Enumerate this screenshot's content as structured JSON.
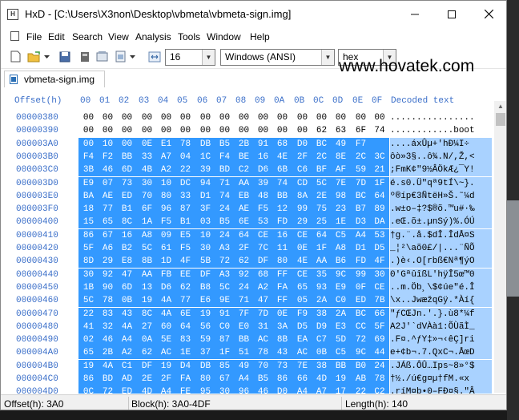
{
  "window": {
    "title": "HxD - [C:\\Users\\X3non\\Desktop\\vbmeta\\vbmeta-sign.img]"
  },
  "menu": [
    "File",
    "Edit",
    "Search",
    "View",
    "Analysis",
    "Tools",
    "Window",
    "Help"
  ],
  "toolbar": {
    "bytes_per_row": "16",
    "charset": "Windows (ANSI)",
    "display_mode": "hex"
  },
  "watermark": "www.hovatek.com",
  "tab": {
    "label": "vbmeta-sign.img"
  },
  "header": {
    "offset_label": "Offset(h)",
    "columns": [
      "00",
      "01",
      "02",
      "03",
      "04",
      "05",
      "06",
      "07",
      "08",
      "09",
      "0A",
      "0B",
      "0C",
      "0D",
      "0E",
      "0F"
    ],
    "decoded_label": "Decoded text"
  },
  "rows": [
    {
      "offset": "00000380",
      "bytes": [
        "00",
        "00",
        "00",
        "00",
        "00",
        "00",
        "00",
        "00",
        "00",
        "00",
        "00",
        "00",
        "00",
        "00",
        "00",
        "00"
      ],
      "decoded": "................"
    },
    {
      "offset": "00000390",
      "bytes": [
        "00",
        "00",
        "00",
        "00",
        "00",
        "00",
        "00",
        "00",
        "00",
        "00",
        "00",
        "00",
        "62",
        "63",
        "6F",
        "74"
      ],
      "decoded": "............boot"
    },
    {
      "offset": "000003A0",
      "bytes": [
        "00",
        "10",
        "00",
        "0E",
        "E1",
        "78",
        "DB",
        "B5",
        "2B",
        "91",
        "68",
        "D0",
        "BC",
        "49",
        "F7",
        ""
      ],
      "decoded": "....áxÛµ+'hÐ¼I÷"
    },
    {
      "offset": "000003B0",
      "bytes": [
        "F4",
        "F2",
        "BB",
        "33",
        "A7",
        "04",
        "1C",
        "F4",
        "BE",
        "16",
        "4E",
        "2F",
        "2C",
        "8E",
        "2C",
        "3C"
      ],
      "decoded": "ôò»3§..ô¾.N/,Ž,<"
    },
    {
      "offset": "000003C0",
      "bytes": [
        "3B",
        "46",
        "6D",
        "4B",
        "A2",
        "22",
        "39",
        "BD",
        "C2",
        "D6",
        "6B",
        "C6",
        "BF",
        "AF",
        "59",
        "21"
      ],
      "decoded": ";FmK¢\"9½ÂÖkÆ¿¯Y!"
    },
    {
      "offset": "000003D0",
      "bytes": [
        "E9",
        "07",
        "73",
        "30",
        "10",
        "DC",
        "94",
        "71",
        "AA",
        "39",
        "74",
        "CD",
        "5C",
        "7E",
        "7D",
        "1F"
      ],
      "decoded": "é.s0.Ü\"qª9tÍ\\~}."
    },
    {
      "offset": "000003E0",
      "bytes": [
        "BA",
        "AE",
        "ED",
        "70",
        "80",
        "33",
        "D1",
        "74",
        "EB",
        "48",
        "BB",
        "8A",
        "2E",
        "98",
        "BC",
        "64"
      ],
      "decoded": "º®íp€3ÑtëH»Š.˜¼d"
    },
    {
      "offset": "000003F0",
      "bytes": [
        "18",
        "77",
        "B1",
        "6F",
        "96",
        "87",
        "3F",
        "24",
        "AE",
        "F5",
        "12",
        "99",
        "75",
        "23",
        "B7",
        "89"
      ],
      "decoded": ".w±o–‡?$®õ.™u#·‰"
    },
    {
      "offset": "00000400",
      "bytes": [
        "15",
        "65",
        "8C",
        "1A",
        "F5",
        "B1",
        "03",
        "B5",
        "6E",
        "53",
        "FD",
        "29",
        "25",
        "1E",
        "D3",
        "DA"
      ],
      "decoded": ".eŒ.õ±.µnSý)%.ÓÚ"
    },
    {
      "offset": "00000410",
      "bytes": [
        "86",
        "67",
        "16",
        "A8",
        "09",
        "E5",
        "10",
        "24",
        "64",
        "CE",
        "16",
        "CE",
        "64",
        "C5",
        "A4",
        "53"
      ],
      "decoded": "†g.¨.å.$dÎ.ÎdÅ¤S"
    },
    {
      "offset": "00000420",
      "bytes": [
        "5F",
        "A6",
        "B2",
        "5C",
        "61",
        "F5",
        "30",
        "A3",
        "2F",
        "7C",
        "11",
        "0E",
        "1F",
        "A8",
        "D1",
        "D5"
      ],
      "decoded": "_¦²\\aõ0£/|...¨ÑÕ"
    },
    {
      "offset": "00000430",
      "bytes": [
        "8D",
        "29",
        "E8",
        "8B",
        "1D",
        "4F",
        "5B",
        "72",
        "62",
        "DF",
        "80",
        "4E",
        "AA",
        "B6",
        "FD",
        "4F"
      ],
      "decoded": ".)è‹.O[rbß€Nª¶ýO"
    },
    {
      "offset": "00000440",
      "bytes": [
        "30",
        "92",
        "47",
        "AA",
        "FB",
        "EE",
        "DF",
        "A3",
        "92",
        "68",
        "FF",
        "CE",
        "35",
        "9C",
        "99",
        "30"
      ],
      "decoded": "0'GªûîßL'hÿÎ5œ™0"
    },
    {
      "offset": "00000450",
      "bytes": [
        "1B",
        "90",
        "6D",
        "13",
        "D6",
        "62",
        "B8",
        "5C",
        "24",
        "A2",
        "FA",
        "65",
        "93",
        "E9",
        "0F",
        "CE"
      ],
      "decoded": "..m.Öb¸\\$¢úe\"é.Î"
    },
    {
      "offset": "00000460",
      "bytes": [
        "5C",
        "78",
        "0B",
        "19",
        "4A",
        "77",
        "E6",
        "9E",
        "71",
        "47",
        "FF",
        "05",
        "2A",
        "C0",
        "ED",
        "7B"
      ],
      "decoded": "\\x..JwæžqGÿ.*Àí{"
    },
    {
      "offset": "00000470",
      "bytes": [
        "22",
        "83",
        "43",
        "8C",
        "4A",
        "6E",
        "19",
        "91",
        "7F",
        "7D",
        "0E",
        "F9",
        "38",
        "2A",
        "BC",
        "66"
      ],
      "decoded": "\"ƒCŒJn.'.}.ù8*¼f"
    },
    {
      "offset": "00000480",
      "bytes": [
        "41",
        "32",
        "4A",
        "27",
        "60",
        "64",
        "56",
        "C0",
        "E0",
        "31",
        "3A",
        "D5",
        "D9",
        "E3",
        "CC",
        "5F"
      ],
      "decoded": "A2J'`dVÀà1:ÕÙãÌ_"
    },
    {
      "offset": "00000490",
      "bytes": [
        "02",
        "46",
        "A4",
        "0A",
        "5E",
        "83",
        "59",
        "87",
        "BB",
        "AC",
        "8B",
        "EA",
        "C7",
        "5D",
        "72",
        "69"
      ],
      "decoded": ".F¤.^ƒY‡»¬‹êÇ]ri"
    },
    {
      "offset": "000004A0",
      "bytes": [
        "65",
        "2B",
        "A2",
        "62",
        "AC",
        "1E",
        "37",
        "1F",
        "51",
        "78",
        "43",
        "AC",
        "0B",
        "C5",
        "9C",
        "44"
      ],
      "decoded": "e+¢b¬.7.QxC¬.ÅœD"
    },
    {
      "offset": "000004B0",
      "bytes": [
        "19",
        "4A",
        "C1",
        "DF",
        "19",
        "D4",
        "DB",
        "85",
        "49",
        "70",
        "73",
        "7E",
        "38",
        "BB",
        "B0",
        "24"
      ],
      "decoded": ".JÁß.ÔÛ…Ips~8»°$"
    },
    {
      "offset": "000004C0",
      "bytes": [
        "86",
        "BD",
        "AD",
        "2E",
        "2F",
        "FA",
        "80",
        "67",
        "A4",
        "B5",
        "86",
        "66",
        "4D",
        "19",
        "AB",
        "78"
      ],
      "decoded": "†½­./ú€g¤µ†fM.«x"
    },
    {
      "offset": "000004D0",
      "bytes": [
        "0C",
        "72",
        "ED",
        "4D",
        "A4",
        "FE",
        "95",
        "30",
        "96",
        "46",
        "D0",
        "A4",
        "A7",
        "17",
        "22",
        "C2"
      ],
      "decoded": ".ríM¤þ•0–FÐ¤§.\"Â"
    }
  ],
  "status": {
    "offset": "Offset(h): 3A0",
    "block": "Block(h): 3A0-4DF",
    "length": "Length(h): 140"
  }
}
